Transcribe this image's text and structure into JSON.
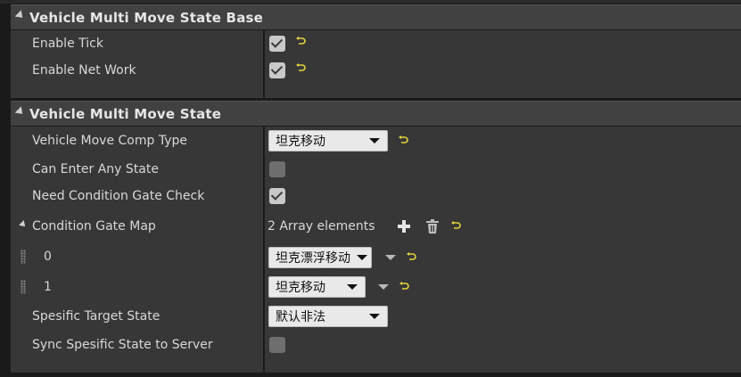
{
  "sections": [
    {
      "title": "Vehicle Multi Move State Base",
      "rows": [
        {
          "label": "Enable Tick",
          "checked": true
        },
        {
          "label": "Enable Net Work",
          "checked": true
        }
      ]
    },
    {
      "title": "Vehicle Multi Move State",
      "rows": [
        {
          "label": "Vehicle Move Comp Type",
          "value": "坦克移动"
        },
        {
          "label": "Can Enter Any State",
          "checked": false
        },
        {
          "label": "Need Condition Gate Check",
          "checked": true
        },
        {
          "label": "Condition Gate Map",
          "value": "2 Array elements"
        },
        {
          "label": "0",
          "value": "坦克漂浮移动"
        },
        {
          "label": "1",
          "value": "坦克移动"
        },
        {
          "label": "Spesific Target State",
          "value": "默认非法"
        },
        {
          "label": "Sync Spesific State to Server",
          "checked": false
        }
      ]
    }
  ],
  "colors": {
    "panel": "#373737",
    "header": "#414141",
    "reset_arrow": "#e3d43a",
    "checkbox_on": "#c9c9c9",
    "checkbox_off": "#6e6e6e"
  },
  "icons": [
    "expand-triangle-icon",
    "reset-to-default-icon",
    "add-element-icon",
    "trash-icon",
    "drag-grip-icon",
    "dropdown-arrow-icon",
    "checkmark-icon"
  ]
}
